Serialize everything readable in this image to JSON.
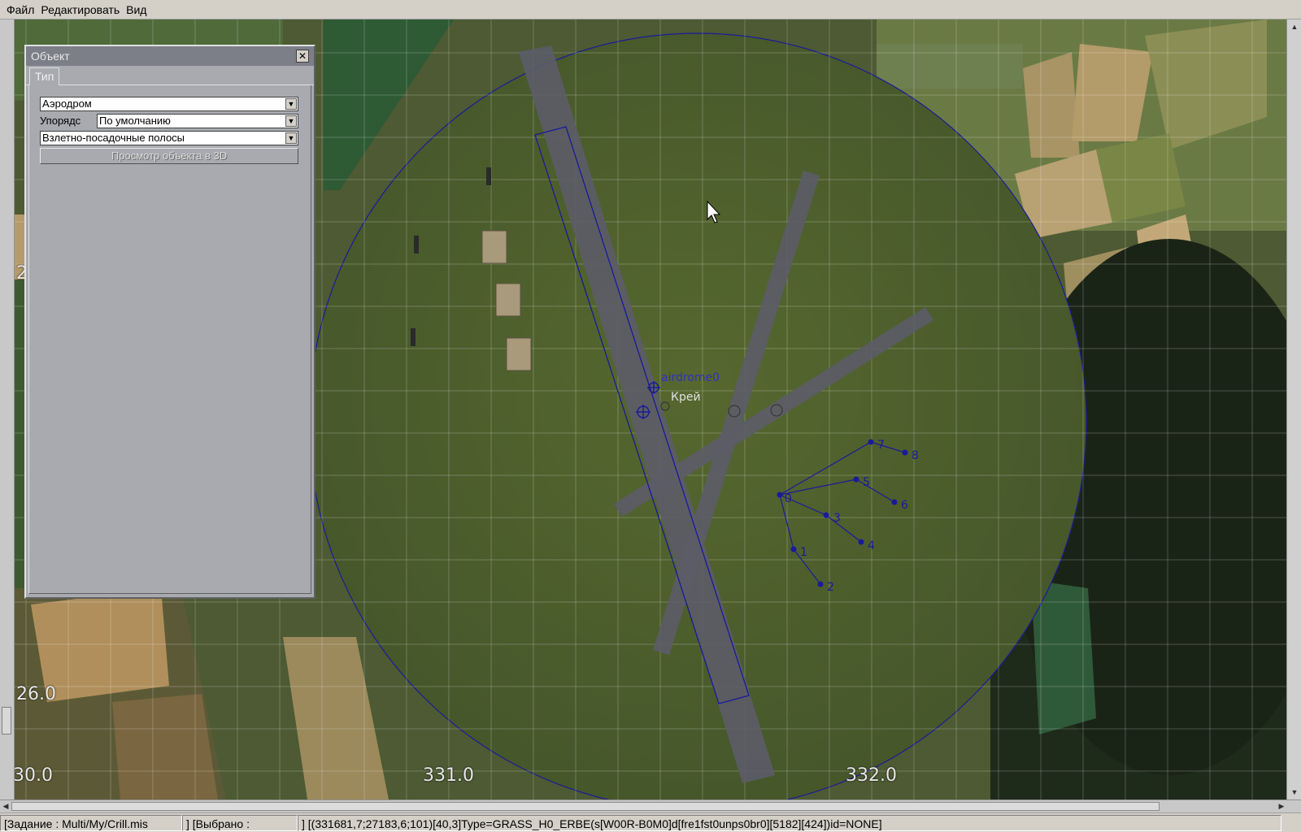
{
  "menu": {
    "file": "Файл",
    "edit": "Редактировать",
    "view": "Вид"
  },
  "panel": {
    "title": "Объект",
    "close_glyph": "✕",
    "tab_type": "Тип",
    "type_value": "Аэродром",
    "order_label": "Упорядс",
    "order_value": "По умолчанию",
    "subtype_value": "Взлетно-посадочные полосы",
    "view3d_label": "Просмотр объекта в 3D"
  },
  "map": {
    "coords": {
      "left_edge_2": "2",
      "y_26": "26.0",
      "x_330": "30.0",
      "x_331": "331.0",
      "x_332": "332.0"
    },
    "airdrome_label": "airdrome0",
    "kray_label": "Крей",
    "waypoints": [
      "0",
      "1",
      "2",
      "3",
      "4",
      "5",
      "6",
      "7",
      "8"
    ]
  },
  "status": {
    "mission": "[Задание : Multi/My/Crill.mis",
    "selected": "] [Выбрано :",
    "info": "] [(331681,7;27183,6;101)[40,3]Type=GRASS_H0_ERBE(s[W00R-B0M0]d[fre1fst0unps0br0][5182][424])id=NONE]"
  },
  "colors": {
    "route": "#1a1a9a",
    "runway": "#5a5a66",
    "grid": "#ffffff",
    "panel": "#a8aab0"
  }
}
